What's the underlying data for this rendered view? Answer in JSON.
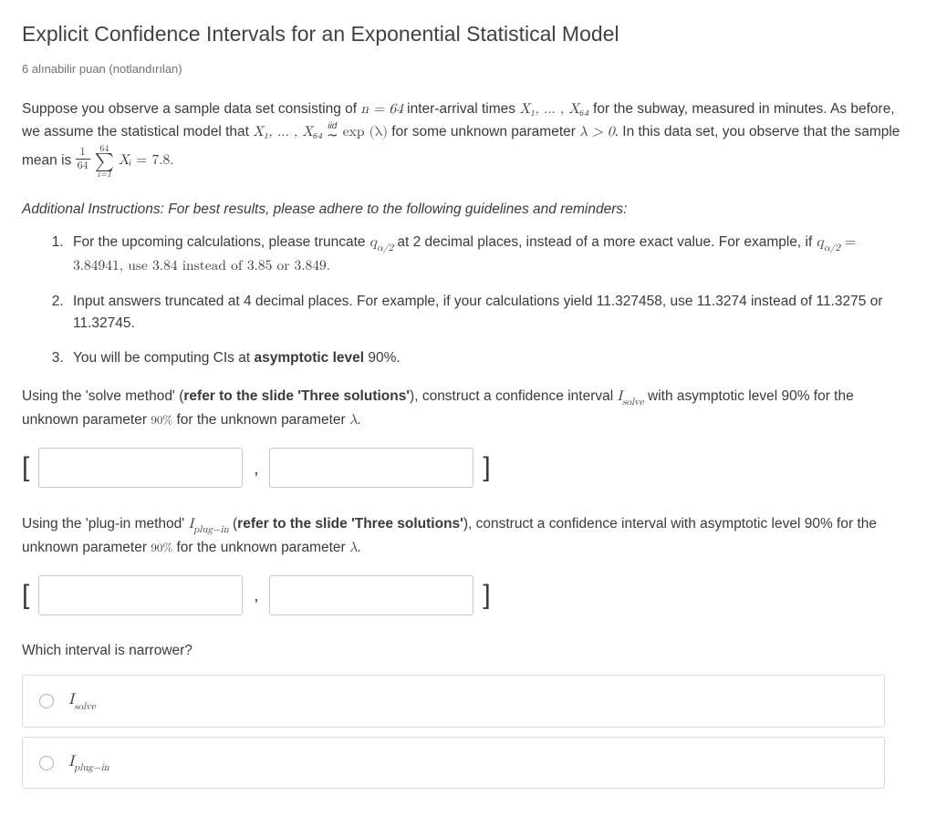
{
  "title": "Explicit Confidence Intervals for an Exponential Statistical Model",
  "points_line": "6 alınabilir puan (notlandırılan)",
  "para1_a": "Suppose you observe a sample data set consisting of ",
  "n_eq": "n = 64",
  "para1_b": " inter-arrival times ",
  "X_range": "X₁, … , X₆₄",
  "para1_c": " for the subway, measured in minutes. As before, we assume the statistical model that ",
  "iid_label": "iid",
  "distr": " exp (λ)",
  "para1_d": " for some unknown parameter ",
  "lambda_cond": "λ > 0",
  "para1_e": ". In this data set, you observe that the sample mean is ",
  "frac_num": "1",
  "frac_den": "64",
  "sum_top": "64",
  "sum_bot": "i=1",
  "Xi": "Xᵢ",
  "mean_val": " = 7.8.",
  "instructions_title": "Additional Instructions: For best results, please adhere to the following guidelines and reminders:",
  "li1_a": "For the upcoming calculations, please truncate ",
  "q_a2": "q",
  "q_a2_sub": "α/2",
  "li1_b": " at 2 decimal places, instead of a more exact value. For example, if ",
  "li1_c": " = 3.84941, use 3.84 instead of 3.85 or 3.849.",
  "li2": "Input answers truncated at 4 decimal places. For example, if your calculations yield 11.327458, use 11.3274 instead of 11.3275 or 11.32745.",
  "li3_a": "You will be computing CIs at ",
  "li3_b": "asymptotic level",
  "li3_c": " 90%.",
  "prompt_solve_a": "Using the 'solve method' (",
  "prompt_ref": "refer to the slide 'Three solutions'",
  "prompt_solve_b": "), construct a confidence interval ",
  "I_solve": "I",
  "I_solve_sub": "solve",
  "prompt_solve_c": " with asymptotic level 90% for the unknown parameter ",
  "lambda": "λ",
  "period": ".",
  "prompt_plugin_a": "Using the 'plug-in method' ",
  "I_plugin": "I",
  "I_plugin_sub": "plug−in",
  "prompt_plugin_b": " (",
  "prompt_plugin_c": "), construct a confidence interval with asymptotic level 90% for the unknown parameter ",
  "narrower_q": "Which interval is narrower?",
  "opt1": "I",
  "opt1_sub": "solve",
  "opt2": "I",
  "opt2_sub": "plug−in",
  "bracket_l": "[",
  "bracket_r": "]",
  "comma": ","
}
